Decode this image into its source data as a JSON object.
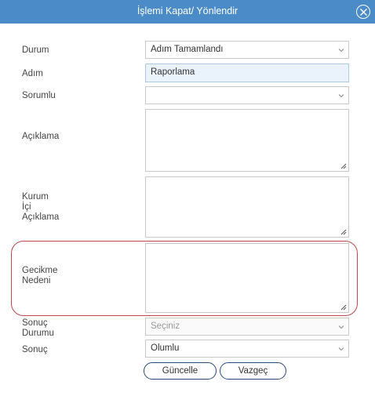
{
  "window": {
    "title": "İşlemi Kapat/ Yönlendir"
  },
  "form": {
    "durum": {
      "label": "Durum",
      "value": "Adım Tamamlandı"
    },
    "adim": {
      "label": "Adım",
      "value": "Raporlama"
    },
    "sorumlu": {
      "label": "Sorumlu",
      "value": ""
    },
    "aciklama": {
      "label": "Açıklama",
      "value": ""
    },
    "kurum_ici_aciklama": {
      "label_lines": [
        "Kurum",
        "İçi",
        "Açıklama"
      ],
      "value": ""
    },
    "gecikme_nedeni": {
      "label_lines": [
        "Gecikme",
        "Nedeni"
      ],
      "value": ""
    },
    "sonuc_durumu": {
      "label_lines": [
        "Sonuç",
        "Durumu"
      ],
      "placeholder": "Seçiniz"
    },
    "sonuc": {
      "label": "Sonuç",
      "value": "Olumlu"
    }
  },
  "buttons": {
    "update": "Güncelle",
    "cancel": "Vazgeç"
  },
  "colors": {
    "titlebar": "#4a8bc8",
    "highlight": "#c0474a",
    "button_border": "#2a4a7a"
  }
}
